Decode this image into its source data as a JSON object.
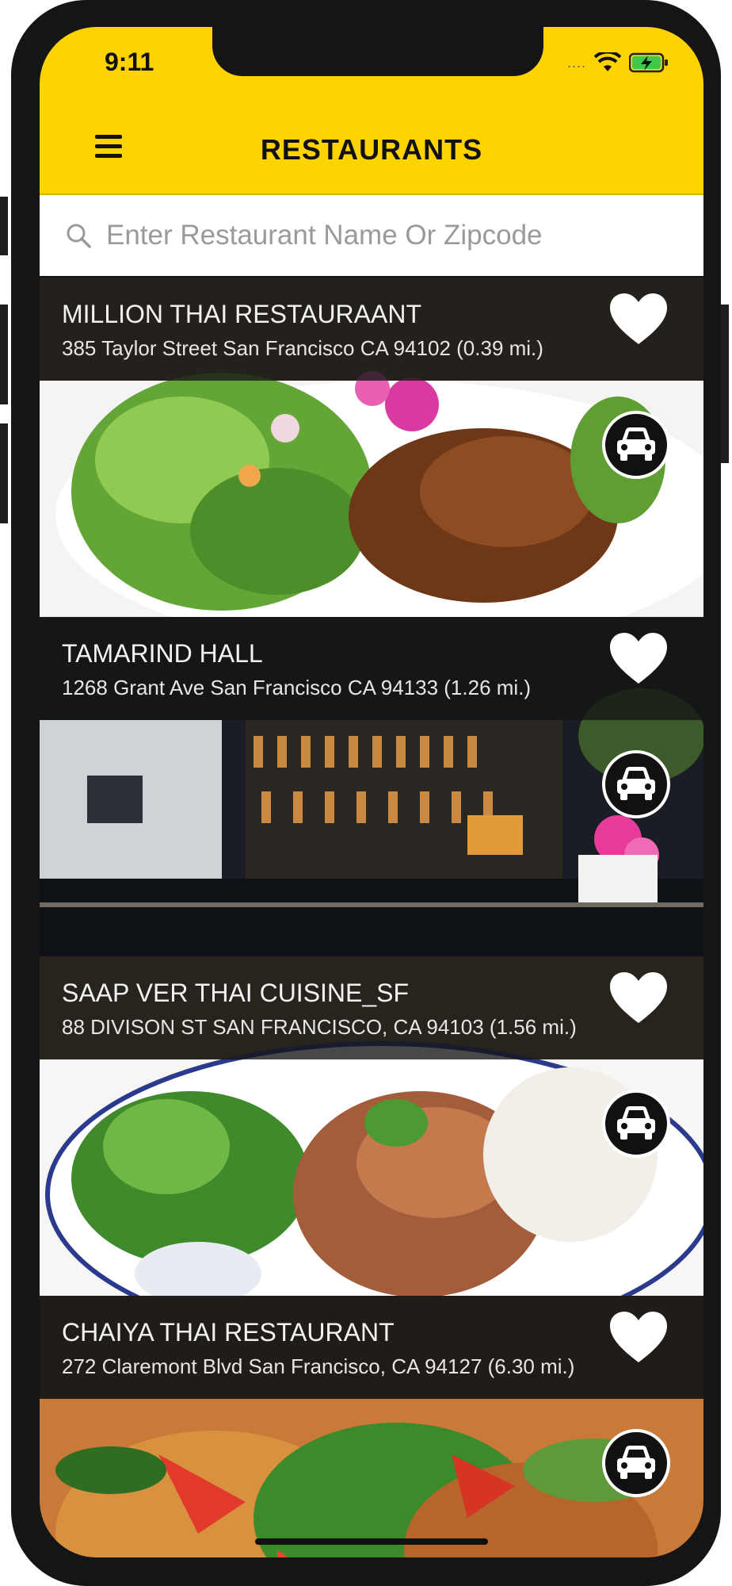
{
  "status_bar": {
    "time": "9:11",
    "signal_dots": "....",
    "icons": [
      "wifi-icon",
      "battery-charging-icon"
    ]
  },
  "header": {
    "title": "RESTAURANTS",
    "menu_icon": "hamburger-menu-icon",
    "background_color": "#ffd300"
  },
  "search": {
    "placeholder": "Enter Restaurant Name Or Zipcode",
    "value": "",
    "icon": "search-icon"
  },
  "restaurants": [
    {
      "name": "MILLION THAI RESTAURAANT",
      "address": "385 Taylor Street  San Francisco CA 94102  (0.39 mi.)",
      "favorite_icon": "heart-icon",
      "directions_icon": "car-icon"
    },
    {
      "name": "TAMARIND HALL",
      "address": "1268 Grant Ave   San Francisco CA 94133  (1.26 mi.)",
      "favorite_icon": "heart-icon",
      "directions_icon": "car-icon"
    },
    {
      "name": "SAAP VER THAI CUISINE_SF",
      "address": "88 DIVISON ST   SAN FRANCISCO, CA 94103  (1.56 mi.)",
      "favorite_icon": "heart-icon",
      "directions_icon": "car-icon"
    },
    {
      "name": "CHAIYA THAI RESTAURANT",
      "address": "272 Claremont Blvd   San Francisco, CA 94127  (6.30 mi.)",
      "favorite_icon": "heart-icon",
      "directions_icon": "car-icon"
    }
  ]
}
